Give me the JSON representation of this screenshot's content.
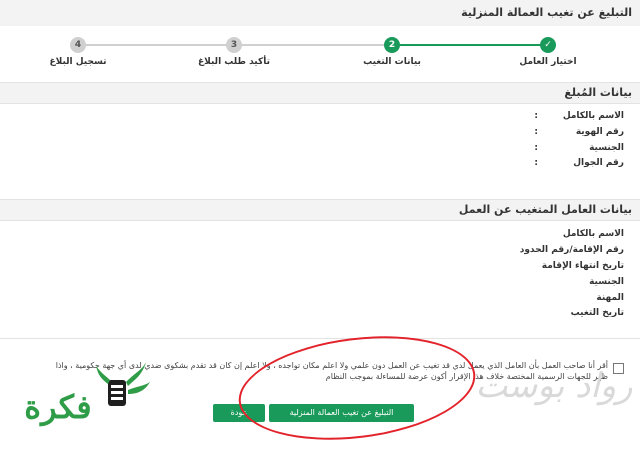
{
  "header": {
    "title": "التبليغ عن تغيب العمالة المنزلية"
  },
  "steps": [
    {
      "number": "✓",
      "label": "اختيار العامل",
      "state": "done"
    },
    {
      "number": "2",
      "label": "بيانات التغيب",
      "state": "active"
    },
    {
      "number": "3",
      "label": "تأكيد طلب البلاغ",
      "state": "todo"
    },
    {
      "number": "4",
      "label": "تسجيل البلاغ",
      "state": "todo"
    }
  ],
  "reporter_section": {
    "title": "بيانات المُبلغ",
    "fields": [
      {
        "label": "الاسم بالكامل",
        "value": ":"
      },
      {
        "label": "رقم الهوية",
        "value": ":"
      },
      {
        "label": "الجنسية",
        "value": ":"
      },
      {
        "label": "رقم الجوال",
        "value": ":"
      }
    ]
  },
  "worker_section": {
    "title": "بيانات العامل المتغيب عن العمل",
    "fields": [
      {
        "label": "الاسم بالكامل"
      },
      {
        "label": "رقم الإقامة/رقم الحدود"
      },
      {
        "label": "تاريخ انتهاء الإقامة"
      },
      {
        "label": "الجنسية"
      },
      {
        "label": "المهنة"
      },
      {
        "label": "تاريخ التغيب"
      }
    ]
  },
  "agreement": {
    "line1": "أقر أنا صاحب العمل بأن العامل الذي يعمل لدي قد تغيب عن العمل دون علمي ولا اعلم مكان تواجده ، ولا اعلم إن كان قد تقدم بشكوى ضدي لدى أي جهة حكومية ، واذا",
    "line2": "ظهر للجهات الرسمية المختصة خلاف هذا الإقرار أكون عرضة للمساءلة بموجب النظام",
    "checked": false
  },
  "buttons": {
    "submit": "التبليغ عن تغيب العمالة المنزلية",
    "back": "عودة"
  },
  "watermark": {
    "left_text": "فكرة",
    "right_text": "رواد بوست"
  },
  "colors": {
    "accent": "#1a9a5a",
    "annotation": "#e3232b",
    "header_bg": "#f3f3f3"
  }
}
